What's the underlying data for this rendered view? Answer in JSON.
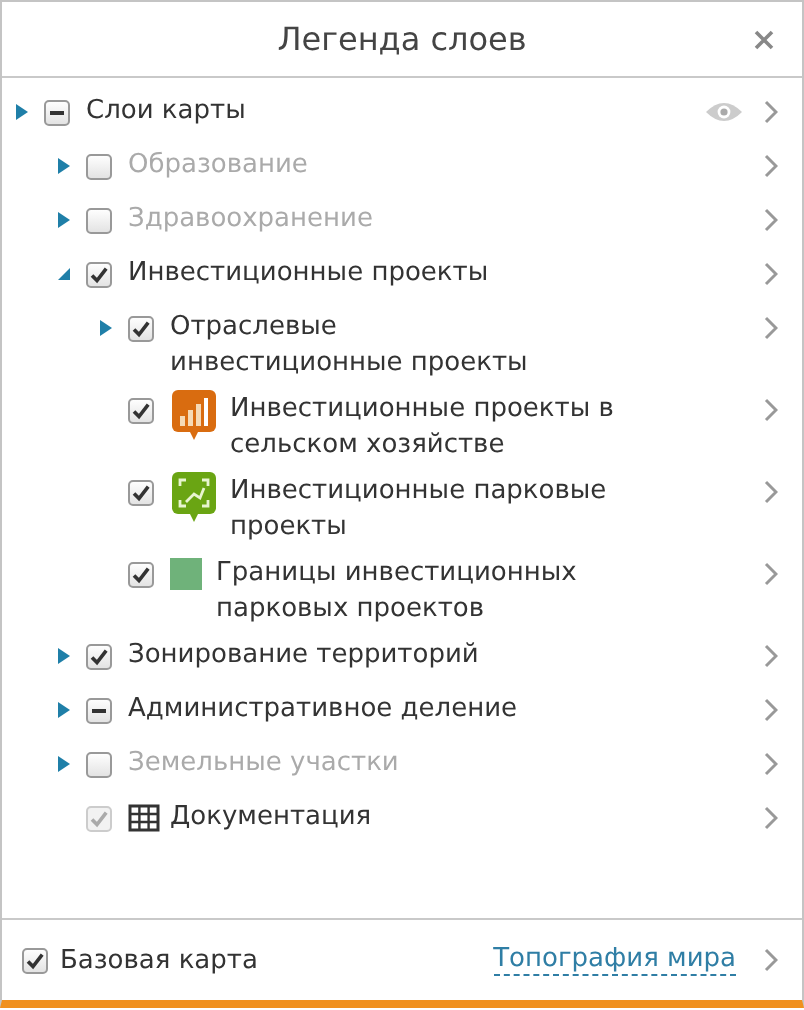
{
  "window": {
    "title": "Легенда слоев"
  },
  "layers": [
    {
      "label": "Слои карты",
      "checked": false,
      "mixed": true,
      "disabled": false,
      "expanded": false,
      "show_eye": true,
      "children": [
        {
          "label": "Образование",
          "checked": false,
          "mixed": false,
          "disabled": false,
          "expanded": false
        },
        {
          "label": "Здравоохранение",
          "checked": false,
          "mixed": false,
          "disabled": false,
          "expanded": false
        },
        {
          "label": "Инвестиционные проекты",
          "checked": true,
          "mixed": false,
          "disabled": false,
          "expanded": true,
          "children": [
            {
              "label": "Отраслевые инвестиционные проекты",
              "checked": true,
              "mixed": false,
              "disabled": false,
              "expanded": false
            },
            {
              "label": "Инвестиционные проекты в сельском хозяйстве",
              "checked": true,
              "mixed": false,
              "disabled": false,
              "kind": "orange-marker"
            },
            {
              "label": "Инвестиционные парковые проекты",
              "checked": true,
              "mixed": false,
              "disabled": false,
              "kind": "green-marker"
            },
            {
              "label": "Границы инвестиционных парковых проектов",
              "checked": true,
              "mixed": false,
              "disabled": false,
              "kind": "swatch",
              "color": "#6fb27a"
            }
          ]
        },
        {
          "label": "Зонирование территорий",
          "checked": true,
          "mixed": false,
          "disabled": false,
          "expanded": false
        },
        {
          "label": "Административное деление",
          "checked": false,
          "mixed": true,
          "disabled": false,
          "expanded": false
        },
        {
          "label": "Земельные участки",
          "checked": false,
          "mixed": false,
          "disabled": false,
          "expanded": false
        },
        {
          "label": "Документация",
          "checked": true,
          "mixed": false,
          "disabled": true,
          "kind": "table"
        }
      ]
    }
  ],
  "basemap": {
    "label": "Базовая карта",
    "checked": true,
    "value": "Топография мира"
  }
}
